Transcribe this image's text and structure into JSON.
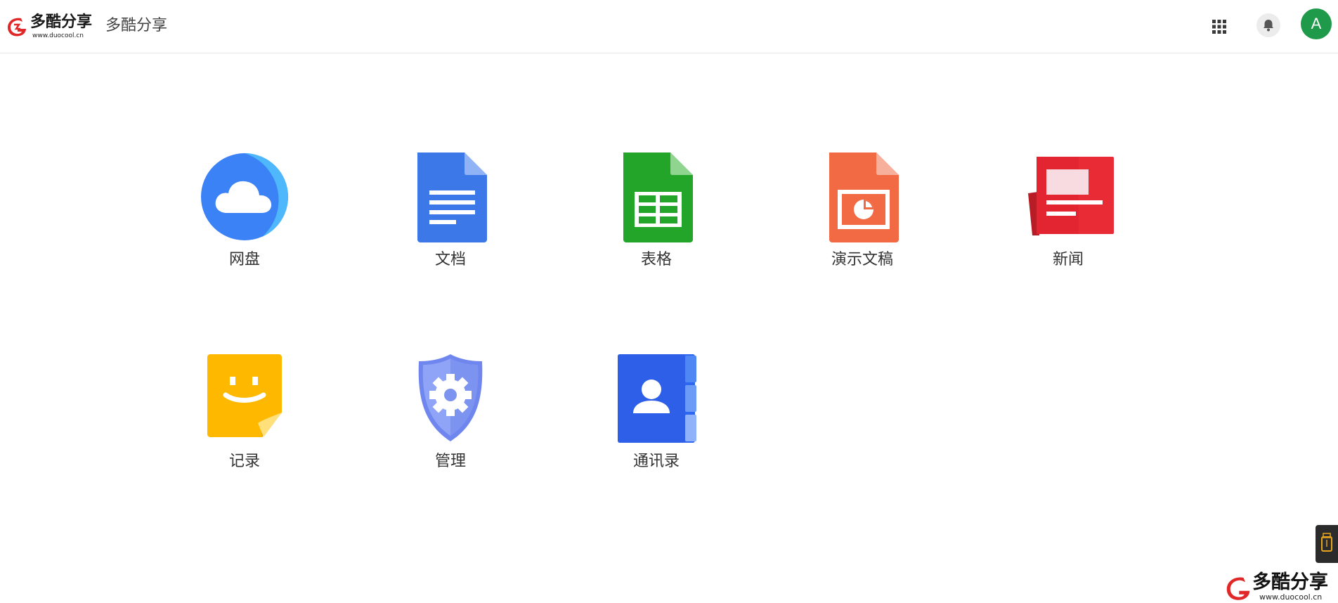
{
  "header": {
    "logo_text": "多酷分享",
    "logo_url": "www.duocool.cn",
    "site_title": "多酷分享",
    "avatar_initial": "A",
    "grid_icon": "apps-grid-icon",
    "bell_icon": "bell-icon"
  },
  "apps": [
    {
      "label": "网盘",
      "icon": "cloud-drive-icon"
    },
    {
      "label": "文档",
      "icon": "document-icon"
    },
    {
      "label": "表格",
      "icon": "spreadsheet-icon"
    },
    {
      "label": "演示文稿",
      "icon": "presentation-icon"
    },
    {
      "label": "新闻",
      "icon": "news-icon"
    },
    {
      "label": "记录",
      "icon": "note-icon"
    },
    {
      "label": "管理",
      "icon": "admin-shield-icon"
    },
    {
      "label": "通讯录",
      "icon": "contacts-icon"
    }
  ],
  "watermark": {
    "text": "多酷分享",
    "url": "www.duocool.cn"
  },
  "colors": {
    "avatar": "#1e9a4a",
    "cloud": "#3b82f6",
    "doc": "#3c78e8",
    "sheet": "#22a529",
    "slides": "#f26a43",
    "news": "#e82b35",
    "note": "#ffb800",
    "shield": "#7c95f2",
    "contacts": "#2f67f0"
  }
}
